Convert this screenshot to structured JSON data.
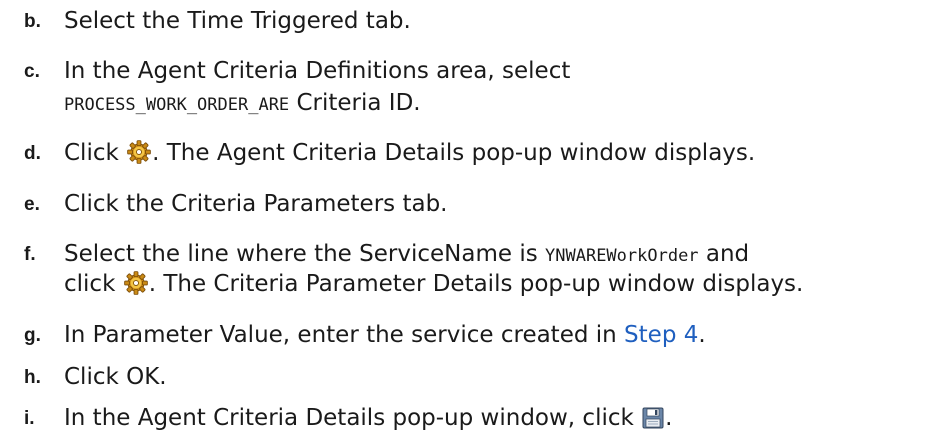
{
  "steps": [
    {
      "letter": "b.",
      "text": "Select the Time Triggered tab."
    },
    {
      "letter": "c.",
      "line1": "In the Agent Criteria Definitions area, select",
      "code": "PROCESS_WORK_ORDER_ARE",
      "line2_after": " Criteria ID."
    },
    {
      "letter": "d.",
      "before": "Click ",
      "icon": "gear-icon",
      "after": ". The Agent Criteria Details pop-up window displays."
    },
    {
      "letter": "e.",
      "text": "Click the Criteria Parameters tab."
    },
    {
      "letter": "f.",
      "line1_before": "Select the line where the ServiceName is ",
      "code": "YNWAREWorkOrder",
      "line1_after": " and",
      "line2_before": "click ",
      "icon": "gear-icon",
      "line2_after": ". The Criteria Parameter Details pop-up window displays."
    },
    {
      "letter": "g.",
      "before": "In Parameter Value, enter the service created in ",
      "link": "Step 4",
      "after": "."
    },
    {
      "letter": "h.",
      "text": "Click OK."
    },
    {
      "letter": "i.",
      "before": "In the Agent Criteria Details pop-up window, click ",
      "icon": "save-icon",
      "after": "."
    }
  ],
  "colors": {
    "text": "#1a1a1a",
    "link": "#1f5fbf"
  }
}
